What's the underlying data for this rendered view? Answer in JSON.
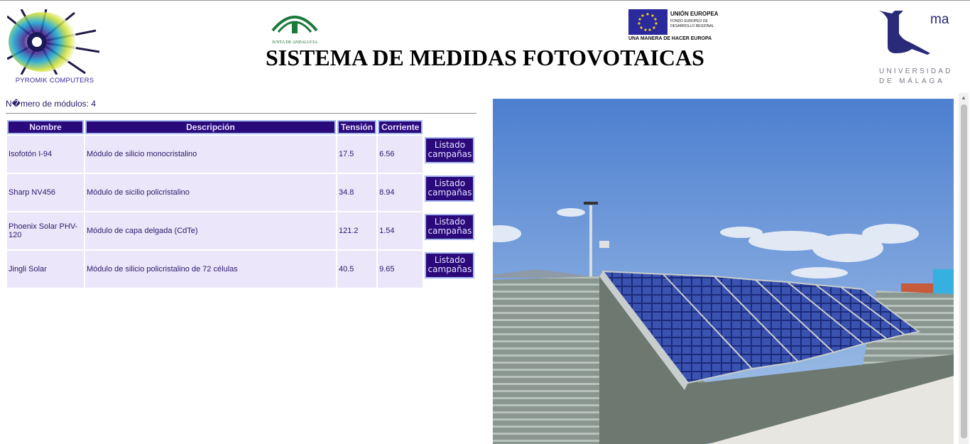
{
  "header": {
    "title": "SISTEMA DE MEDIDAS FOTOVOTAICAS",
    "pyromik_caption": "PYROMIK COMPUTERS",
    "junta_caption": "JUNTA DE ANDALUCIA",
    "eu_title": "UNIÓN EUROPEA",
    "eu_fund": "FONDO EUROPEO DE DESARROLLO REGIONAL",
    "eu_motto": "UNA MANERA DE HACER EUROPA",
    "uma_mark": "ma",
    "uma_line1": "UNIVERSIDAD",
    "uma_line2": "DE MÁLAGA"
  },
  "module_count": "N�mero de módulos: 4",
  "table": {
    "headers": [
      "Nombre",
      "Descripción",
      "Tensión",
      "Corriente"
    ],
    "button_label_1": "Listado",
    "button_label_2": "campañas",
    "rows": [
      {
        "nombre": "Isofotón I-94",
        "descripcion": "Módulo de silicio monocristalino",
        "tension": "17.5",
        "corriente": "6.56"
      },
      {
        "nombre": "Sharp NV456",
        "descripcion": "Módulo de sicilio policristalino",
        "tension": "34.8",
        "corriente": "8.94"
      },
      {
        "nombre": "Phoenix Solar PHV-120",
        "descripcion": "Módulo de capa delgada (CdTe)",
        "tension": "121.2",
        "corriente": "1.54"
      },
      {
        "nombre": "Jingli Solar",
        "descripcion": "Módulo de silicio policristalino de 72 células",
        "tension": "40.5",
        "corriente": "9.65"
      }
    ]
  },
  "colors": {
    "header_bg": "#2a0a7a",
    "header_border": "#a9b9f2",
    "cell_bg": "#ece6fa",
    "text": "#2a1a6a"
  }
}
